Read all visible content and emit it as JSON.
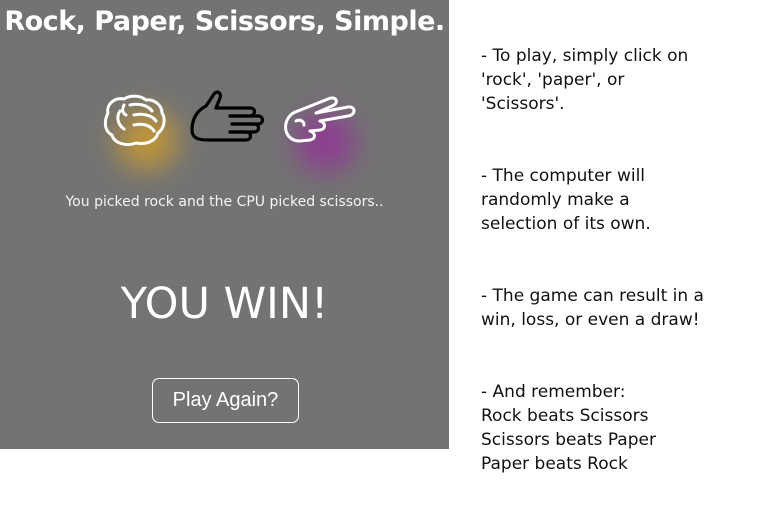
{
  "game": {
    "title": "Rock, Paper, Scissors, Simple.",
    "choices": [
      {
        "id": "rock",
        "label": "rock",
        "icon": "rock-hand-icon",
        "glow_color": "#c9951c"
      },
      {
        "id": "paper",
        "label": "paper",
        "icon": "paper-hand-icon",
        "glow_color": null
      },
      {
        "id": "scissors",
        "label": "scissors",
        "icon": "scissors-hand-icon",
        "glow_color": "#8a2a8f"
      }
    ],
    "status_text": "You picked rock and the CPU picked scissors..",
    "result_text": "YOU WIN!",
    "play_again_label": "Play Again?"
  },
  "instructions": {
    "paragraphs": [
      "- To play, simply click on\n'rock', 'paper', or\n'Scissors'.",
      "- The computer will\nrandomly make a\nselection of its own.",
      "- The game can result in a\nwin, loss, or even a draw!",
      "- And remember:\nRock beats Scissors\nScissors beats Paper\nPaper beats Rock"
    ]
  },
  "colors": {
    "panel_bg": "#737373",
    "text_light": "#ffffff",
    "text_dark": "#111111"
  }
}
